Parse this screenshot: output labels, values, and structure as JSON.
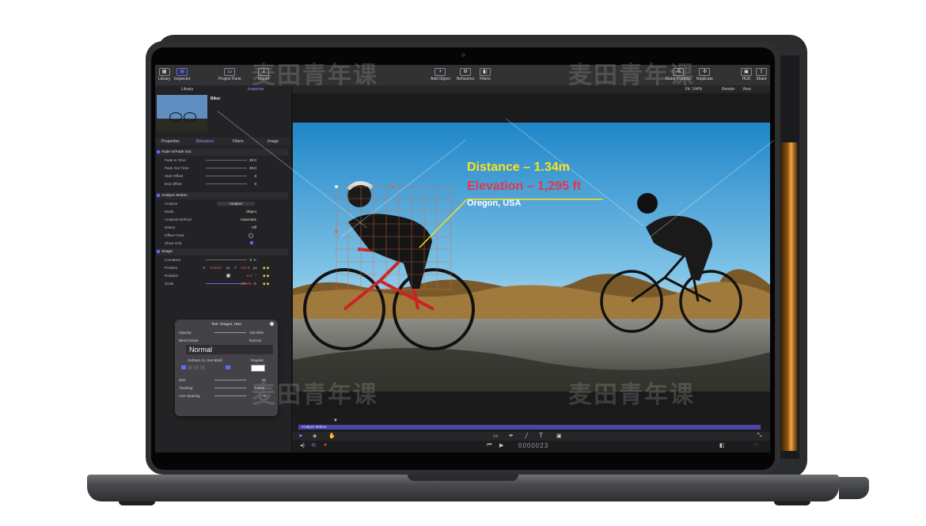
{
  "toolbar": {
    "library": "Library",
    "inspector": "Inspector",
    "project_pane": "Project Pane",
    "import": "Import",
    "add_object": "Add Object",
    "behaviors": "Behaviors",
    "filters": "Filters",
    "make_particles": "Make Particles",
    "replicate": "Replicate",
    "hud": "HUD",
    "share": "Share"
  },
  "viewer_controls": {
    "fit": "Fit: 144%",
    "render": "Render",
    "view": "View"
  },
  "left_panel": {
    "tabs": [
      "Library",
      "Inspector"
    ],
    "object_name": "Biker",
    "inspector_tabs": [
      "Properties",
      "Behaviors",
      "Filters",
      "Image"
    ],
    "fade": {
      "title": "Fade In/Fade Out",
      "rows": [
        {
          "label": "Fade In Time",
          "value": "20.0"
        },
        {
          "label": "Fade Out Time",
          "value": "20.0"
        },
        {
          "label": "Start Offset",
          "value": "0"
        },
        {
          "label": "End Offset",
          "value": "0"
        }
      ]
    },
    "analyze": {
      "title": "Analyze Motion",
      "analyze_label": "Analyze",
      "analyze_button": "Analyze",
      "rows": [
        {
          "label": "Mode",
          "value": "Object"
        },
        {
          "label": "Analysis Method",
          "value": "Automatic"
        },
        {
          "label": "Detect",
          "value": "Off"
        },
        {
          "label": "Offset Track",
          "value": ""
        },
        {
          "label": "Show Grid",
          "value": ""
        }
      ]
    },
    "shape": {
      "title": "Shape",
      "rows": [
        {
          "label": "Curvature",
          "value": "0",
          "unit": "%"
        },
        {
          "label": "Position",
          "x_label": "X",
          "x": "-1233.9",
          "x_unit": "px",
          "y_label": "Y",
          "y": "137.8",
          "y_unit": "px"
        },
        {
          "label": "Rotation",
          "value": "6.4",
          "unit": "°"
        },
        {
          "label": "Scale",
          "value": "436.01",
          "unit": "%"
        }
      ]
    }
  },
  "hud": {
    "title": "Text: Oregon, USA",
    "opacity_label": "Opacity",
    "opacity_value": "100.00%",
    "blend_label": "Blend Mode",
    "blend_value": "Normal",
    "preset": "Normal",
    "font": "Gotham A1 SemiBold",
    "weight": "Regular",
    "size_label": "Size",
    "size_value": "82",
    "tracking_label": "Tracking",
    "tracking_value": "0.00%",
    "line_spacing_label": "Line Spacing",
    "line_spacing_value": "0"
  },
  "overlay_text": {
    "distance": "Distance – 1.34m",
    "elevation": "Elevation – 1,295 ft",
    "location": "Oregon, USA"
  },
  "timeline": {
    "track_label": "Analyze Motion",
    "timecode": "0000023"
  },
  "watermark": "麦田青年课",
  "colors": {
    "accent": "#5b6cff",
    "distance_text": "#ffe01a",
    "elevation_text": "#e8364a",
    "track_bar": "#4a47a8",
    "value_red": "#ff5a5a"
  }
}
